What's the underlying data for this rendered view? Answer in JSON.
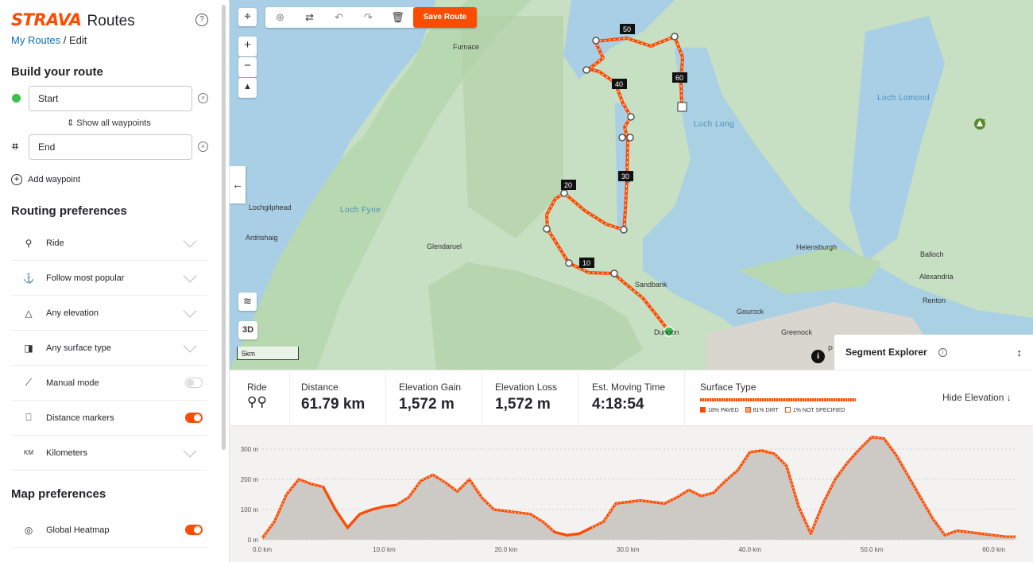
{
  "brand": {
    "logo": "STRAVA",
    "product": "Routes"
  },
  "breadcrumb": {
    "parent": "My Routes",
    "current": "/ Edit"
  },
  "build": {
    "title": "Build your route",
    "start_value": "Start",
    "end_value": "End",
    "show_all": "Show all waypoints",
    "add_waypoint": "Add waypoint"
  },
  "routing": {
    "title": "Routing preferences",
    "items": [
      {
        "label": "Ride",
        "icon": "bike-icon",
        "control": "dropdown"
      },
      {
        "label": "Follow most popular",
        "icon": "popular-icon",
        "control": "dropdown"
      },
      {
        "label": "Any elevation",
        "icon": "elevation-icon",
        "control": "dropdown"
      },
      {
        "label": "Any surface type",
        "icon": "surface-icon",
        "control": "dropdown"
      },
      {
        "label": "Manual mode",
        "icon": "manual-icon",
        "control": "toggle",
        "on": false
      },
      {
        "label": "Distance markers",
        "icon": "marker-icon",
        "control": "toggle",
        "on": true
      },
      {
        "label": "Kilometers",
        "icon": "km-icon",
        "glyph": "KM",
        "control": "dropdown"
      }
    ]
  },
  "map_prefs": {
    "title": "Map preferences",
    "items": [
      {
        "label": "Global Heatmap",
        "icon": "heatmap-icon",
        "control": "toggle",
        "on": true
      }
    ]
  },
  "toolbar": {
    "save_label": "Save Route"
  },
  "map": {
    "scale_label": "5km",
    "button_3d": "3D",
    "labels": [
      "Furnace",
      "Lochgilphead",
      "Ardrishaig",
      "Glendaruel",
      "Sandbank",
      "Helensburgh",
      "Balloch",
      "Alexandria",
      "Renton",
      "Gourock",
      "Greenock",
      "Dunoon",
      "P"
    ],
    "water_labels": [
      "Loch Fyne",
      "Loch Long",
      "Loch Lomond"
    ],
    "distance_markers": [
      "10",
      "20",
      "30",
      "40",
      "50",
      "60"
    ],
    "segment_explorer": "Segment Explorer"
  },
  "stats": {
    "activity": "Ride",
    "distance_label": "Distance",
    "distance": "61.79 km",
    "gain_label": "Elevation Gain",
    "gain": "1,572 m",
    "loss_label": "Elevation Loss",
    "loss": "1,572 m",
    "time_label": "Est. Moving Time",
    "time": "4:18:54",
    "surface_label": "Surface Type",
    "surface": [
      {
        "label": "18% PAVED",
        "color": "#fc4c02"
      },
      {
        "label": "81% DIRT",
        "color": "#f7a072"
      },
      {
        "label": "1% NOT SPECIFIED",
        "color": "#ffffff"
      }
    ],
    "hide_elevation": "Hide Elevation ↓"
  },
  "chart_data": {
    "type": "area",
    "title": "",
    "xlabel": "",
    "ylabel": "",
    "xlim": [
      0,
      61.79
    ],
    "ylim": [
      0,
      350
    ],
    "x_ticks": [
      "0.0 km",
      "10.0 km",
      "20.0 km",
      "30.0 km",
      "40.0 km",
      "50.0 km",
      "60.0 km"
    ],
    "y_ticks": [
      "0 m",
      "100 m",
      "200 m",
      "300 m"
    ],
    "x": [
      0,
      1,
      2,
      3,
      4,
      5,
      6,
      7,
      8,
      9,
      10,
      11,
      12,
      13,
      14,
      15,
      16,
      17,
      18,
      19,
      20,
      21,
      22,
      23,
      24,
      25,
      26,
      27,
      28,
      29,
      30,
      31,
      32,
      33,
      34,
      35,
      36,
      37,
      38,
      39,
      40,
      41,
      42,
      43,
      44,
      45,
      46,
      47,
      48,
      49,
      50,
      51,
      52,
      53,
      54,
      55,
      56,
      57,
      58,
      59,
      60,
      61,
      61.79
    ],
    "values": [
      5,
      60,
      150,
      200,
      185,
      175,
      100,
      40,
      85,
      100,
      110,
      115,
      140,
      195,
      215,
      190,
      160,
      200,
      140,
      100,
      95,
      90,
      85,
      60,
      25,
      15,
      20,
      40,
      60,
      120,
      125,
      130,
      125,
      120,
      140,
      165,
      145,
      155,
      195,
      230,
      290,
      295,
      285,
      245,
      110,
      20,
      120,
      200,
      255,
      300,
      340,
      335,
      280,
      210,
      140,
      70,
      15,
      30,
      25,
      20,
      15,
      10,
      10
    ],
    "paved_ranges_km": [
      [
        4.5,
        11.5
      ],
      [
        24,
        27
      ]
    ]
  }
}
